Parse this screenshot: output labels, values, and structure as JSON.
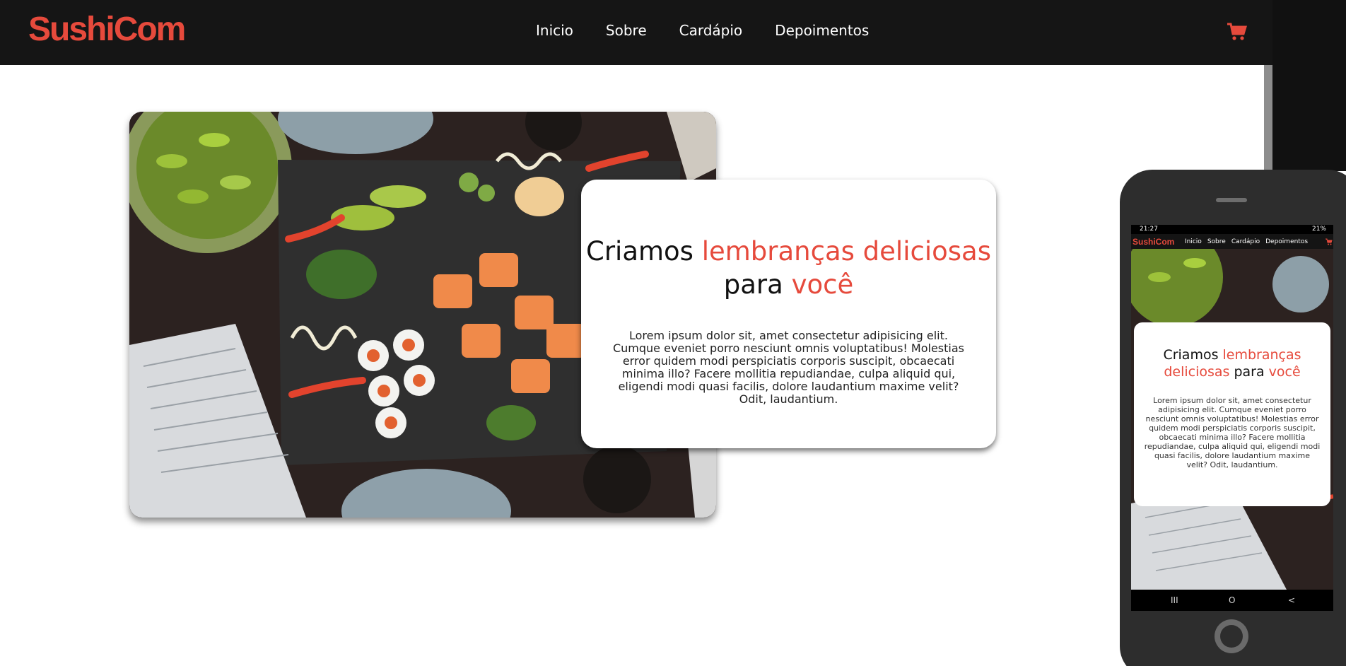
{
  "brand": {
    "name": "SushiCom",
    "accent": "#e64a3c",
    "nav_bg": "#151515"
  },
  "nav": {
    "links": [
      "Inicio",
      "Sobre",
      "Cardápio",
      "Depoimentos"
    ],
    "cart_icon": "shopping-cart-icon"
  },
  "hero": {
    "image": "sushi-platter-photo",
    "title_part1": "Criamos ",
    "title_accent1": "lembranças deliciosas",
    "title_part2": " para ",
    "title_accent2": "você",
    "body": "Lorem ipsum dolor sit, amet consectetur adipisicing elit. Cumque eveniet porro nesciunt omnis voluptatibus! Molestias error quidem modi perspiciatis corporis suscipit, obcaecati minima illo? Facere mollitia repudiandae, culpa aliquid qui, eligendi modi quasi facilis, dolore laudantium maxime velit? Odit, laudantium."
  },
  "phone": {
    "status_time": "21:27",
    "status_battery": "21%",
    "softkeys": [
      "III",
      "O",
      "<"
    ],
    "home_button": "home-button"
  }
}
